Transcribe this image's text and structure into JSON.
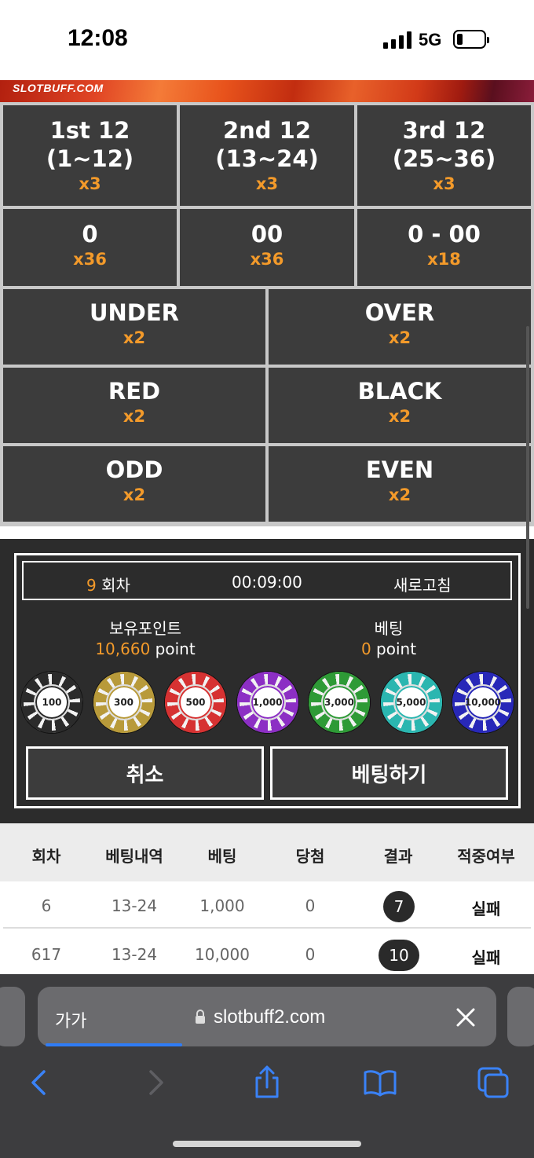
{
  "status": {
    "time": "12:08",
    "network": "5G"
  },
  "banner": {
    "logo": "SLOTBUFF.COM"
  },
  "board": {
    "dozens": [
      {
        "line1": "1st 12",
        "line2": "(1~12)",
        "mult": "x3"
      },
      {
        "line1": "2nd 12",
        "line2": "(13~24)",
        "mult": "x3"
      },
      {
        "line1": "3rd 12",
        "line2": "(25~36)",
        "mult": "x3"
      }
    ],
    "zeros": [
      {
        "label": "0",
        "mult": "x36"
      },
      {
        "label": "00",
        "mult": "x36"
      },
      {
        "label": "0 - 00",
        "mult": "x18"
      }
    ],
    "pairs": [
      {
        "left": {
          "label": "UNDER",
          "mult": "x2"
        },
        "right": {
          "label": "OVER",
          "mult": "x2"
        }
      },
      {
        "left": {
          "label": "RED",
          "mult": "x2"
        },
        "right": {
          "label": "BLACK",
          "mult": "x2"
        }
      },
      {
        "left": {
          "label": "ODD",
          "mult": "x2"
        },
        "right": {
          "label": "EVEN",
          "mult": "x2"
        }
      }
    ]
  },
  "panel": {
    "round_number": "9",
    "round_label": "회차",
    "timer": "00:09:00",
    "refresh": "새로고침",
    "points_label": "보유포인트",
    "points_value": "10,660",
    "points_unit": "point",
    "bet_label": "베팅",
    "bet_value": "0",
    "bet_unit": "point",
    "chips": [
      {
        "value": "100",
        "color": "#2b2b2b"
      },
      {
        "value": "300",
        "color": "#b89a3a"
      },
      {
        "value": "500",
        "color": "#d63232"
      },
      {
        "value": "1,000",
        "color": "#8c2fc4"
      },
      {
        "value": "3,000",
        "color": "#2e9a36"
      },
      {
        "value": "5,000",
        "color": "#2bb6b0"
      },
      {
        "value": "10,000",
        "color": "#2828b8"
      }
    ],
    "cancel": "취소",
    "place_bet": "베팅하기"
  },
  "history": {
    "headers": [
      "회차",
      "베팅내역",
      "베팅",
      "당첨",
      "결과",
      "적중여부"
    ],
    "rows": [
      {
        "round": "6",
        "detail": "13-24",
        "bet": "1,000",
        "win": "0",
        "result": "7",
        "status": "실패"
      },
      {
        "round": "617",
        "detail": "13-24",
        "bet": "10,000",
        "win": "0",
        "result": "10",
        "status": "실패"
      }
    ]
  },
  "browser": {
    "text_size": "가가",
    "url": "slotbuff2.com"
  },
  "colors": {
    "accent": "#f39a2a",
    "cell": "#3c3c3c",
    "browser_blue": "#2f7cf6"
  }
}
